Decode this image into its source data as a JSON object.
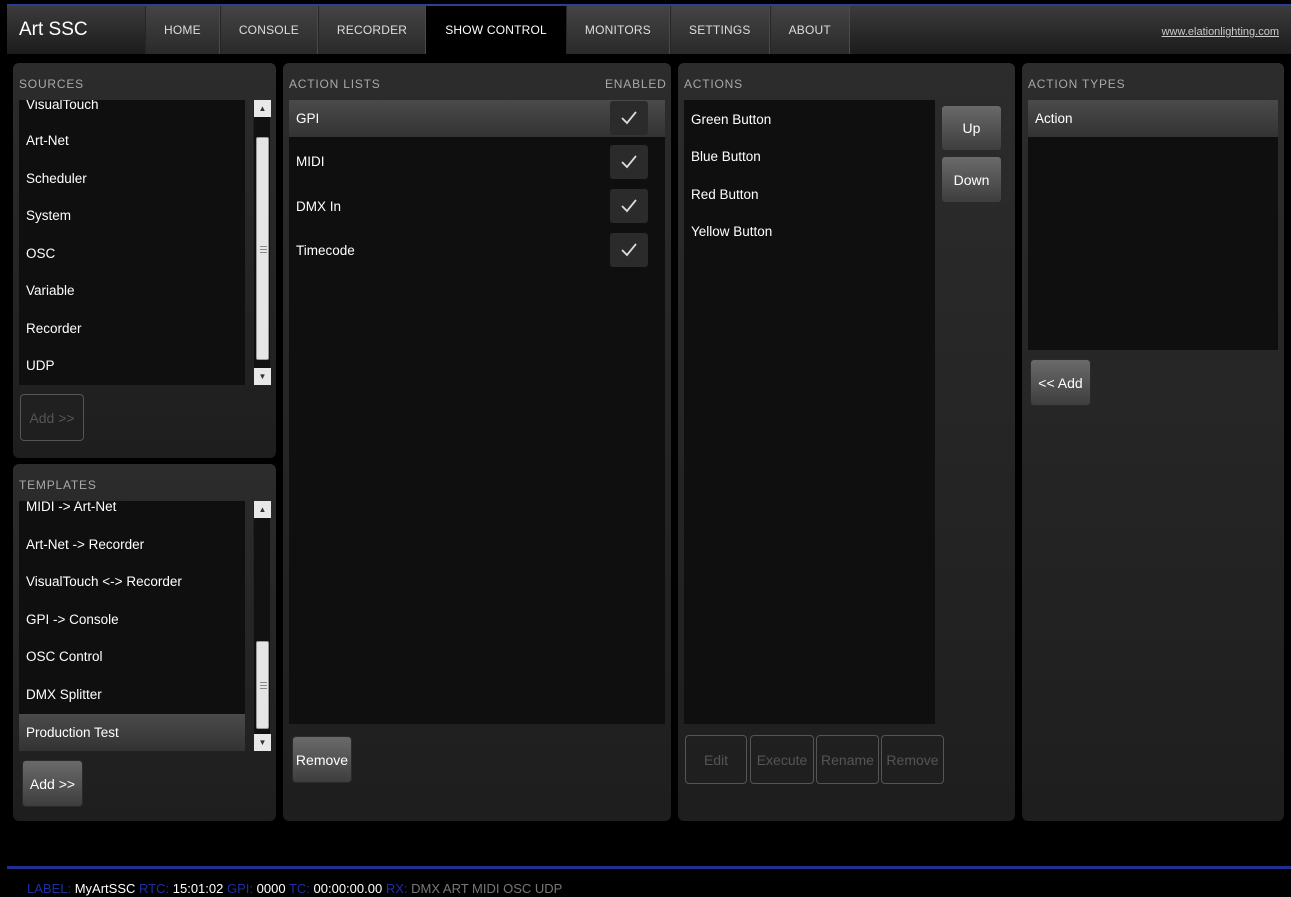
{
  "app": {
    "title": "Art SSC",
    "link": "www.elationlighting.com"
  },
  "nav": [
    {
      "label": "HOME"
    },
    {
      "label": "CONSOLE"
    },
    {
      "label": "RECORDER"
    },
    {
      "label": "SHOW CONTROL",
      "active": true
    },
    {
      "label": "MONITORS"
    },
    {
      "label": "SETTINGS"
    },
    {
      "label": "ABOUT"
    }
  ],
  "sources": {
    "title": "SOURCES",
    "items": [
      "VisualTouch",
      "Art-Net",
      "Scheduler",
      "System",
      "OSC",
      "Variable",
      "Recorder",
      "UDP"
    ],
    "add_label": "Add >>"
  },
  "templates": {
    "title": "TEMPLATES",
    "items": [
      "MIDI -> Art-Net",
      "Art-Net -> Recorder",
      "VisualTouch <-> Recorder",
      "GPI -> Console",
      "OSC Control",
      "DMX Splitter",
      "Production Test"
    ],
    "selected": "Production Test",
    "add_label": "Add >>"
  },
  "action_lists": {
    "title": "ACTION LISTS",
    "enabled_header": "ENABLED",
    "items": [
      {
        "label": "GPI",
        "enabled": true,
        "selected": true
      },
      {
        "label": "MIDI",
        "enabled": true
      },
      {
        "label": "DMX In",
        "enabled": true
      },
      {
        "label": "Timecode",
        "enabled": true
      }
    ],
    "remove_label": "Remove"
  },
  "actions": {
    "title": "ACTIONS",
    "items": [
      "Green Button",
      "Blue Button",
      "Red Button",
      "Yellow Button"
    ],
    "up_label": "Up",
    "down_label": "Down",
    "edit_label": "Edit",
    "execute_label": "Execute",
    "rename_label": "Rename",
    "remove_label": "Remove"
  },
  "action_types": {
    "title": "ACTION TYPES",
    "items": [
      "Action"
    ],
    "add_label": "<< Add"
  },
  "status": {
    "label_key": "LABEL:",
    "label_value": "MyArtSSC",
    "rtc_key": "RTC:",
    "rtc_value": "15:01:02",
    "gpi_key": "GPI:",
    "gpi_value": "0000",
    "tc_key": "TC:",
    "tc_value": "00:00:00.00",
    "rx_key": "RX:",
    "rx_value": "DMX ART MIDI OSC UDP"
  },
  "colors": {
    "accent": "#1d2fa0",
    "panel": "#262626",
    "list_bg": "#0f0f0f"
  }
}
